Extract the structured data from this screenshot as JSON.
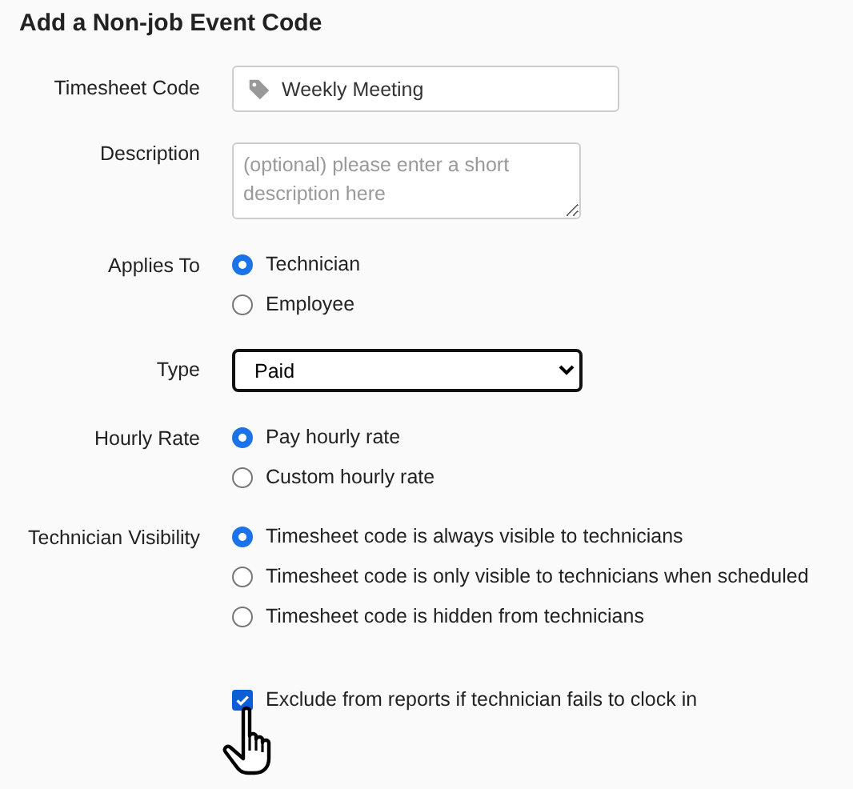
{
  "title": "Add a Non-job Event Code",
  "fields": [
    {
      "kind": "text",
      "label": "Timesheet Code",
      "value": "Weekly Meeting"
    },
    {
      "kind": "textarea",
      "label": "Description",
      "placeholder": "(optional) please enter a short description here"
    },
    {
      "kind": "radio",
      "label": "Applies To",
      "options": [
        {
          "label": "Technician",
          "selected": true
        },
        {
          "label": "Employee",
          "selected": false
        }
      ]
    },
    {
      "kind": "select",
      "label": "Type",
      "value": "Paid"
    },
    {
      "kind": "radio",
      "label": "Hourly Rate",
      "options": [
        {
          "label": "Pay hourly rate",
          "selected": true
        },
        {
          "label": "Custom hourly rate",
          "selected": false
        }
      ]
    },
    {
      "kind": "radio",
      "label": "Technician Visibility",
      "options": [
        {
          "label": "Timesheet code is always visible to technicians",
          "selected": true
        },
        {
          "label": "Timesheet code is only visible to technicians when scheduled",
          "selected": false
        },
        {
          "label": "Timesheet code is hidden from technicians",
          "selected": false
        }
      ]
    }
  ],
  "checkbox": {
    "label": "Exclude from reports if technician fails to clock in",
    "checked": true
  }
}
